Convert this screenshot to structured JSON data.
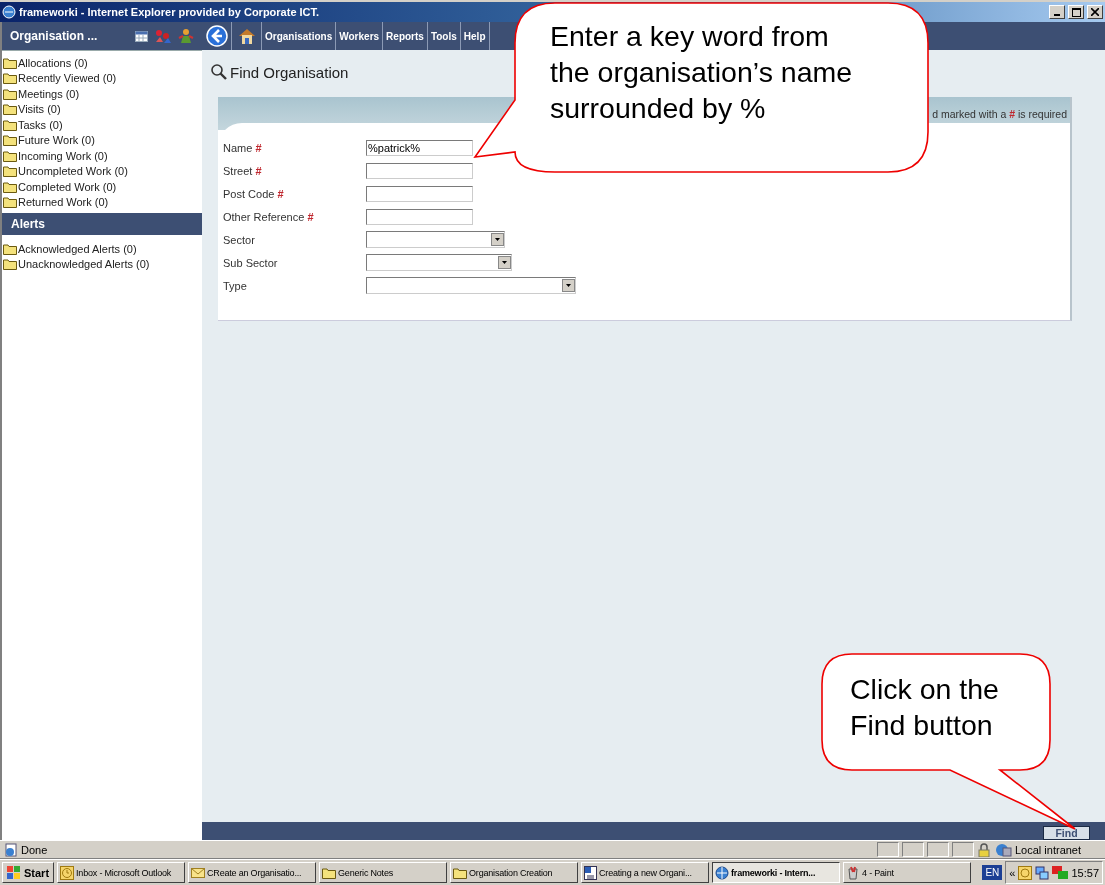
{
  "window": {
    "title": "frameworki - Internet Explorer provided by Corporate ICT."
  },
  "sidebar": {
    "title": "Organisation ...",
    "items": [
      {
        "label": "Allocations (0)"
      },
      {
        "label": "Recently Viewed (0)"
      },
      {
        "label": "Meetings (0)"
      },
      {
        "label": "Visits (0)"
      },
      {
        "label": "Tasks (0)"
      },
      {
        "label": "Future Work (0)"
      },
      {
        "label": "Incoming Work (0)"
      },
      {
        "label": "Uncompleted Work (0)"
      },
      {
        "label": "Completed Work (0)"
      },
      {
        "label": "Returned Work (0)"
      }
    ],
    "alerts_title": "Alerts",
    "alerts": [
      {
        "label": "Acknowledged Alerts (0)"
      },
      {
        "label": "Unacknowledged Alerts (0)"
      }
    ]
  },
  "nav": {
    "items": [
      "Organisations",
      "Workers",
      "Reports",
      "Tools",
      "Help"
    ]
  },
  "page": {
    "title": "Find Organisation"
  },
  "form": {
    "note": {
      "before": "d marked with a",
      "mark": "#",
      "after": "is required"
    },
    "fields": [
      {
        "kind": "text",
        "label": "Name",
        "mark": "#",
        "value": "%patrick%"
      },
      {
        "kind": "text",
        "label": "Street",
        "mark": "#"
      },
      {
        "kind": "text",
        "label": "Post Code",
        "mark": "#"
      },
      {
        "kind": "text",
        "label": "Other Reference",
        "mark": "#"
      },
      {
        "kind": "select",
        "label": "Sector"
      },
      {
        "kind": "select",
        "label": "Sub Sector"
      },
      {
        "kind": "select",
        "label": "Type"
      }
    ]
  },
  "footer": {
    "button": "Find"
  },
  "status_bar": {
    "text": "Done",
    "zone": "Local intranet"
  },
  "taskbar": {
    "start": "Start",
    "items": [
      {
        "label": "Inbox - Microsoft Outlook",
        "kind": "mail",
        "selected": false
      },
      {
        "label": "CReate an Organisatio...",
        "kind": "message",
        "selected": false
      },
      {
        "label": "Generic Notes",
        "kind": "folder",
        "selected": false
      },
      {
        "label": "Organisation Creation",
        "kind": "folder",
        "selected": false
      },
      {
        "label": "Creating a new Organi...",
        "kind": "document",
        "selected": false
      },
      {
        "label": "frameworki - Intern...",
        "kind": "browser",
        "selected": true
      },
      {
        "label": "4 - Paint",
        "kind": "paint",
        "selected": false
      }
    ],
    "language": "EN",
    "chevron": "«",
    "clock": "15:57"
  },
  "callouts": [
    {
      "lines": [
        "Enter a key word from",
        "the organisation’s name",
        "surrounded by %"
      ]
    },
    {
      "lines": [
        "Click on the",
        "Find button"
      ]
    }
  ]
}
